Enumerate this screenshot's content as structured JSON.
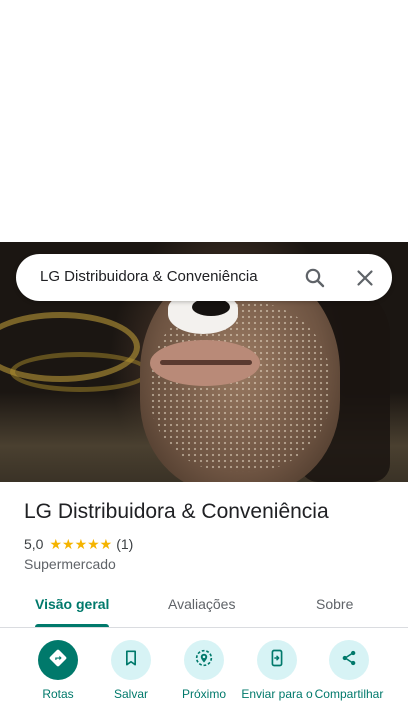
{
  "search": {
    "query": "LG Distribuidora & Conveniência"
  },
  "place": {
    "title": "LG Distribuidora & Conveniência",
    "rating": "5,0",
    "stars": "★★★★★",
    "review_count": "(1)",
    "category": "Supermercado"
  },
  "tabs": [
    {
      "label": "Visão geral",
      "active": true
    },
    {
      "label": "Avaliações",
      "active": false
    },
    {
      "label": "Sobre",
      "active": false
    }
  ],
  "actions": [
    {
      "label": "Rotas",
      "icon": "directions-icon"
    },
    {
      "label": "Salvar",
      "icon": "bookmark-icon"
    },
    {
      "label": "Próximo",
      "icon": "nearby-icon"
    },
    {
      "label": "Enviar para o",
      "icon": "send-to-phone-icon"
    },
    {
      "label": "Compartilhar",
      "icon": "share-icon"
    }
  ],
  "colors": {
    "accent": "#00796b",
    "action_bg": "#d7f3f5",
    "star": "#f5b400"
  }
}
